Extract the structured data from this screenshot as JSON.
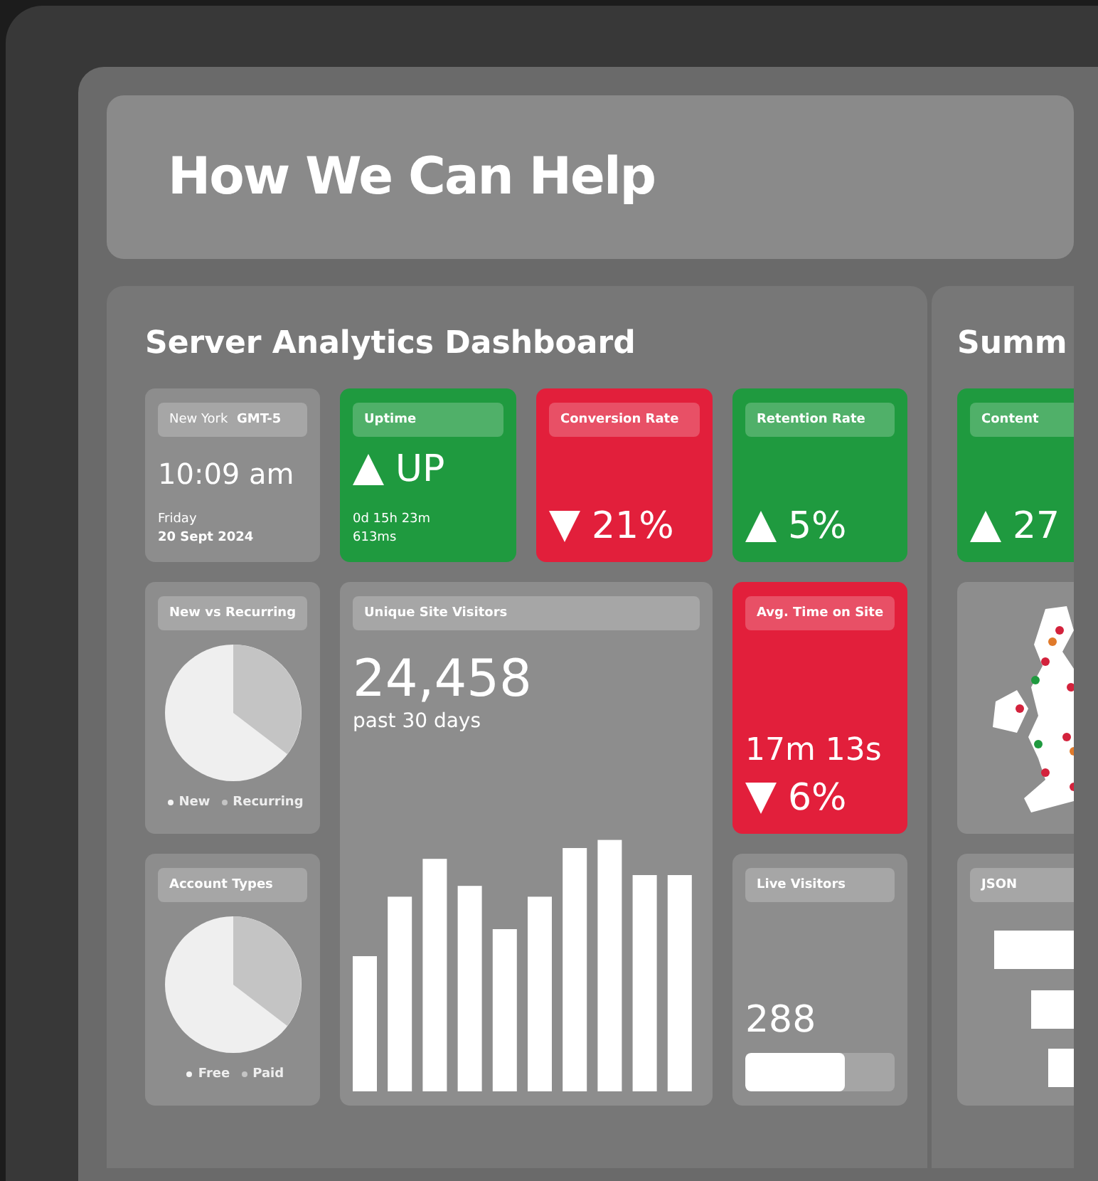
{
  "header": {
    "title": "How We Can Help"
  },
  "dashboard": {
    "title": "Server Analytics Dashboard",
    "clock": {
      "label": "New York",
      "zone": "GMT-5",
      "time": "10:09 am",
      "day": "Friday",
      "date": "20 Sept 2024"
    },
    "uptime": {
      "label": "Uptime",
      "rising": true,
      "status": "UP",
      "duration": "0d 15h 23m",
      "latency": "613ms"
    },
    "stats": [
      {
        "label": "Conversion Rate",
        "rising": false,
        "value": "21%"
      },
      {
        "label": "Retention Rate",
        "rising": true,
        "value": "5%"
      }
    ],
    "pies": [
      {
        "label": "New vs Recurring",
        "legend": [
          "New",
          "Recurring"
        ]
      },
      {
        "label": "Account Types",
        "legend": [
          "Free",
          "Paid"
        ]
      }
    ],
    "visitors": {
      "label": "Unique Site Visitors",
      "value": "24,458",
      "period": "past 30 days"
    },
    "avg_time": {
      "label": "Avg. Time on Site",
      "rising": false,
      "value": "17m 13s",
      "change": "6%"
    },
    "live": {
      "label": "Live Visitors",
      "value": "288",
      "level": 0.67
    }
  },
  "summary": {
    "title": "Summ",
    "content": {
      "label": "Content",
      "rising": true,
      "value": "27"
    },
    "json": {
      "label": "JSON"
    }
  }
}
